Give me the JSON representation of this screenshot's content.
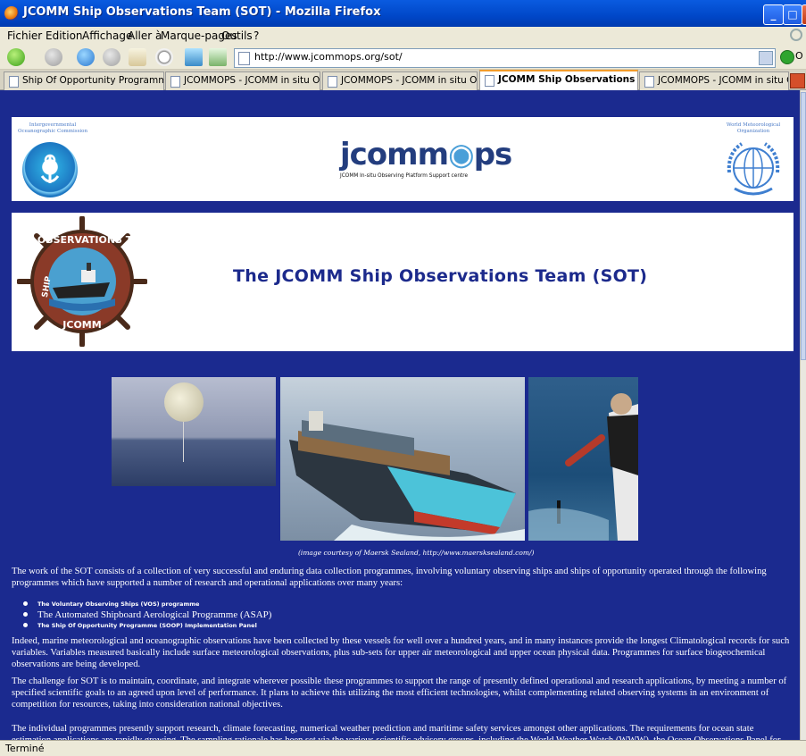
{
  "window": {
    "title": "JCOMM Ship Observations Team (SOT) - Mozilla Firefox"
  },
  "menu": [
    "Fichier",
    "Edition",
    "Affichage",
    "Aller à",
    "Marque-pages",
    "Outils",
    "?"
  ],
  "navbar": {
    "url": "http://www.jcommops.org/sot/",
    "go_label": "O"
  },
  "tabs": [
    "Ship Of Opportunity Programme (SO...",
    "JCOMMOPS - JCOMM in situ Observi...",
    "JCOMMOPS - JCOMM in situ Observi...",
    "JCOMM Ship Observations Tea...",
    "JCOMMOPS - JCOMM in situ Observi..."
  ],
  "header": {
    "ioc_text": "Intergovernmental Oceanographic Commission",
    "logo_word_a": "jcomm",
    "logo_word_b": "ps",
    "logo_subtitle": "JCOMM In-situ Observing Platform Support centre",
    "wmo_text": "World Meteorological Organization"
  },
  "sot_banner": {
    "title": "The JCOMM Ship Observations Team (SOT)",
    "emblem_top": "SHIP OBSERVATIONS TEAM",
    "emblem_bottom": "JCOMM",
    "emblem_left": "SHIP"
  },
  "caption": "(image courtesy of Maersk Sealand, http://www.maersksealand.com/)",
  "intro": "The work of the SOT consists of a collection of very successful and enduring data collection programmes, involving voluntary observing ships and ships of opportunity operated through the following programmes which have supported a number of research and operational applications over many years:",
  "programmes": [
    {
      "label": "The Voluntary Observing Ships (VOS) programme",
      "style": "small"
    },
    {
      "label": "The Automated Shipboard Aerological Programme (ASAP)",
      "style": "big"
    },
    {
      "label": "The Ship Of Opportunity Programme (SOOP) Implementation Panel",
      "style": "small"
    }
  ],
  "para2": "Indeed, marine meteorological and oceanographic observations have been collected by these vessels for well over a hundred years, and in many instances provide the longest Climatological records for such variables. Variables measured basically include surface meteorological observations, plus sub-sets for upper air meteorological and upper ocean physical data. Programmes for surface biogeochemical observations are being developed.",
  "para3": "The challenge for SOT is to maintain, coordinate, and integrate wherever possible these programmes to support the range of presently defined operational and research applications, by meeting a number of specified scientific goals to an agreed upon level of performance. It plans to achieve this utilizing the most efficient technologies, whilst complementing related observing systems in an environment of competition for resources, taking into consideration national objectives.",
  "para4": "The individual programmes presently support research, climate forecasting, numerical weather prediction and maritime safety services amongst other applications. The requirements for ocean state estimation applications are rapidly growing. The sampling rationale has been set via the various scientific advisory groups, including the World Weather Watch (WWW), the Ocean Observations Panel for Climate (OOPC), the Atmospheric",
  "status": "Terminé",
  "colors": {
    "page_bg": "#1b2a8f",
    "title_blue": "#1c2a8c",
    "titlebar": "#0047c8"
  }
}
